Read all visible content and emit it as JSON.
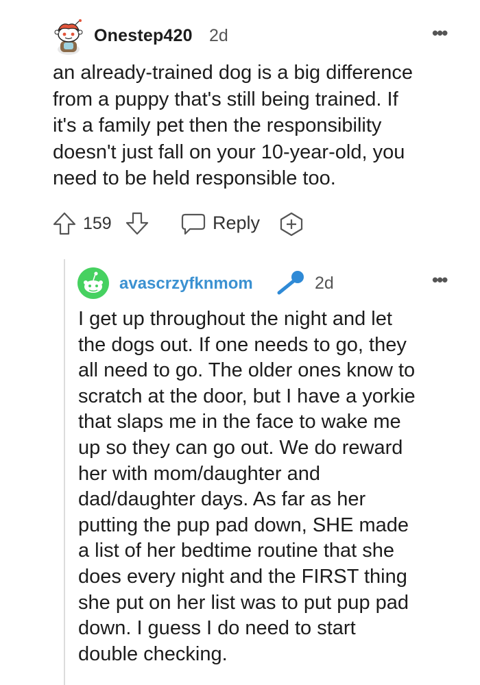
{
  "parent_comment": {
    "author": "Onestep420",
    "age": "2d",
    "more_label": "•••",
    "body": "an already-trained dog is a big difference\nfrom a puppy that's still being trained. If\nit's a family pet then the responsibility\ndoesn't just fall on your 10-year-old, you\nneed to be held responsible too.",
    "vote_count": "159",
    "reply_label": "Reply"
  },
  "reply_comment": {
    "author": "avascrzyfknmom",
    "age": "2d",
    "more_label": "•••",
    "body": "I get up throughout the night and let\nthe dogs out. If one needs to go, they\nall need to go. The older ones know to\nscratch at the door, but I have a yorkie\nthat slaps me in the face to wake me\nup so they can go out. We do reward\nher with mom/daughter and\ndad/daughter days. As far as her\nputting the pup pad down, SHE made\na list of her bedtime routine that she\ndoes every night and the FIRST thing\nshe put on her list was to put pup pad\ndown. I guess I do need to start\ndouble checking."
  },
  "colors": {
    "text": "#1c1c1c",
    "meta": "#555555",
    "reply_author": "#3b91d1",
    "avatar_green": "#46d160",
    "thread_line": "#dcdcdc"
  },
  "icons": [
    "snoo-avatar-icon",
    "more-options-icon",
    "upvote-icon",
    "downvote-icon",
    "reply-bubble-icon",
    "award-icon",
    "microphone-icon"
  ]
}
